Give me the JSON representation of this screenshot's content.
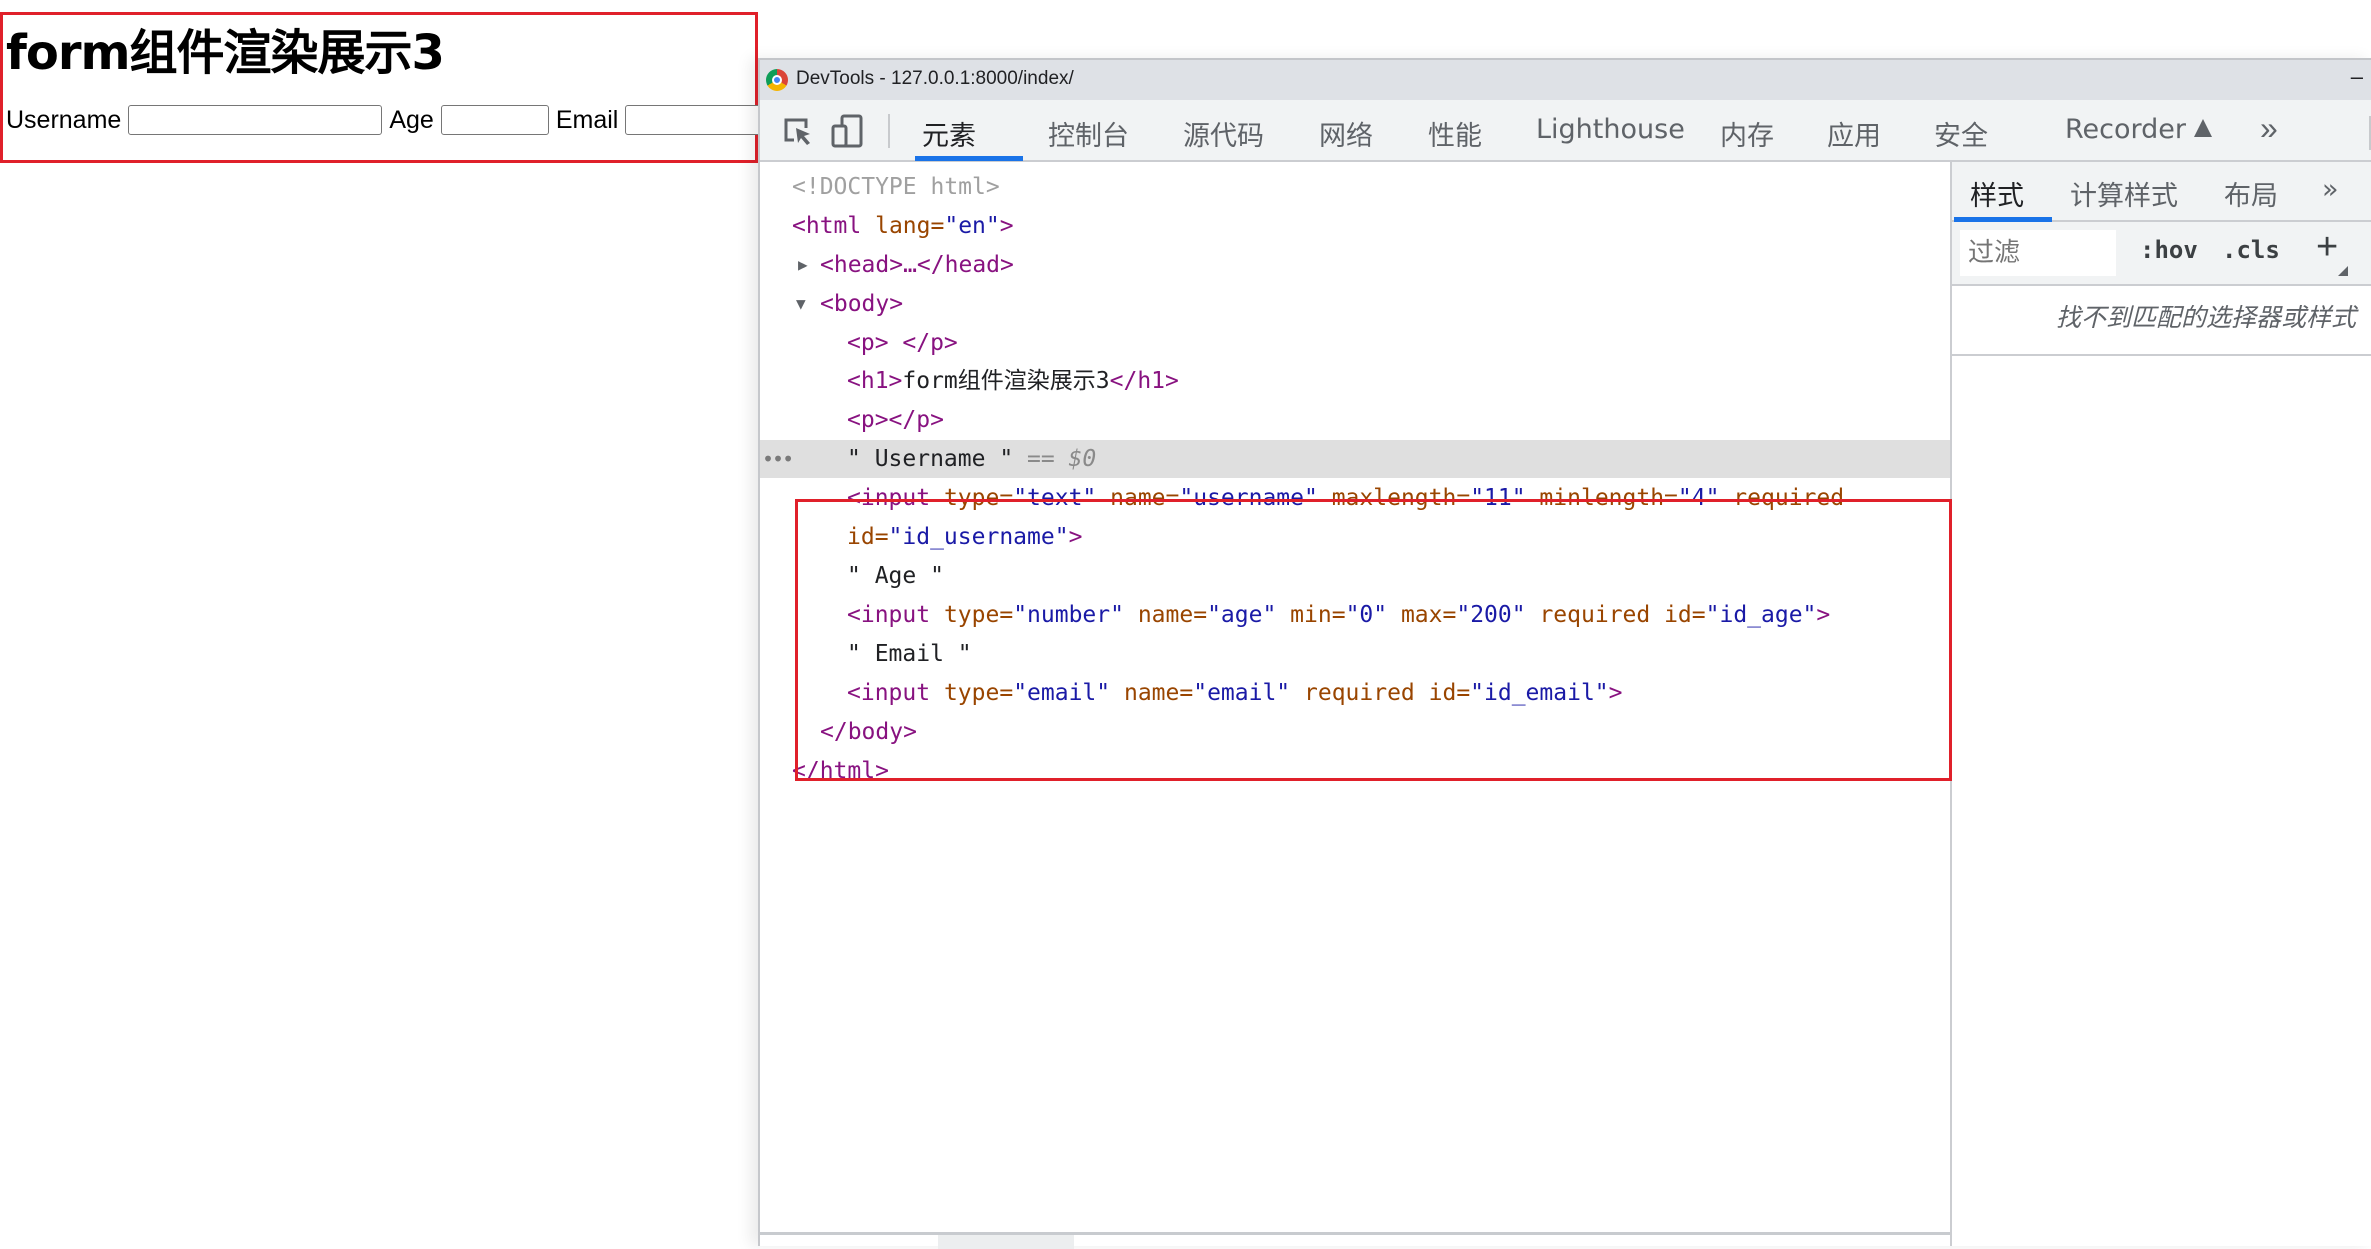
{
  "page": {
    "heading": "form组件渲染展示3",
    "fields": [
      {
        "label": "Username",
        "value": ""
      },
      {
        "label": "Age",
        "value": ""
      },
      {
        "label": "Email",
        "value": ""
      }
    ]
  },
  "devtools": {
    "window_title": "DevTools - 127.0.0.1:8000/index/",
    "minimize_label": "–",
    "tabs": [
      "元素",
      "控制台",
      "源代码",
      "网络",
      "性能",
      "Lighthouse",
      "内存",
      "应用",
      "安全",
      "Recorder"
    ],
    "active_tab": "元素",
    "more_tabs": "»",
    "elements_tree": {
      "doctype": "<!DOCTYPE html>",
      "html_open": {
        "tag": "<html",
        "attr": " lang=",
        "val": "\"en\"",
        "close": ">"
      },
      "head": "<head>…</head>",
      "body_open": "<body>",
      "p1": "<p> </p>",
      "h1_open": "<h1>",
      "h1_text": "form组件渲染展示3",
      "h1_close": "</h1>",
      "p2": "<p></p>",
      "username_text": "\" Username \"",
      "selected_marker": " == $0",
      "input_username": {
        "line1": [
          {
            "k": "tag",
            "t": "<input"
          },
          {
            "k": "attr",
            "t": " type="
          },
          {
            "k": "val",
            "t": "\"text\""
          },
          {
            "k": "attr",
            "t": " name="
          },
          {
            "k": "val",
            "t": "\"username\""
          },
          {
            "k": "attr",
            "t": " maxlength="
          },
          {
            "k": "val",
            "t": "\"11\""
          },
          {
            "k": "attr",
            "t": " minlength="
          },
          {
            "k": "val",
            "t": "\"4\""
          },
          {
            "k": "attr",
            "t": " required"
          }
        ],
        "line2": [
          {
            "k": "attr",
            "t": "id="
          },
          {
            "k": "val",
            "t": "\"id_username\""
          },
          {
            "k": "tag",
            "t": ">"
          }
        ]
      },
      "age_text": "\" Age \"",
      "input_age": [
        {
          "k": "tag",
          "t": "<input"
        },
        {
          "k": "attr",
          "t": " type="
        },
        {
          "k": "val",
          "t": "\"number\""
        },
        {
          "k": "attr",
          "t": " name="
        },
        {
          "k": "val",
          "t": "\"age\""
        },
        {
          "k": "attr",
          "t": " min="
        },
        {
          "k": "val",
          "t": "\"0\""
        },
        {
          "k": "attr",
          "t": " max="
        },
        {
          "k": "val",
          "t": "\"200\""
        },
        {
          "k": "attr",
          "t": " required id="
        },
        {
          "k": "val",
          "t": "\"id_age\""
        },
        {
          "k": "tag",
          "t": ">"
        }
      ],
      "email_text": "\" Email \"",
      "input_email": [
        {
          "k": "tag",
          "t": "<input"
        },
        {
          "k": "attr",
          "t": " type="
        },
        {
          "k": "val",
          "t": "\"email\""
        },
        {
          "k": "attr",
          "t": " name="
        },
        {
          "k": "val",
          "t": "\"email\""
        },
        {
          "k": "attr",
          "t": " required id="
        },
        {
          "k": "val",
          "t": "\"id_email\""
        },
        {
          "k": "tag",
          "t": ">"
        }
      ],
      "body_close": "</body>",
      "html_close": "</html>",
      "row_menu": "•••"
    },
    "styles_pane": {
      "tabs": [
        "样式",
        "计算样式",
        "布局"
      ],
      "active_tab": "样式",
      "more": "»",
      "filter_placeholder": "过滤",
      "hov": ":hov",
      "cls": ".cls",
      "add": "+",
      "empty_message": "找不到匹配的选择器或样式"
    }
  },
  "colors": {
    "highlight_border": "#e0202a",
    "accent": "#1a73e8",
    "tag": "#881280",
    "attr_name": "#994500",
    "attr_value": "#1a1aa6"
  }
}
